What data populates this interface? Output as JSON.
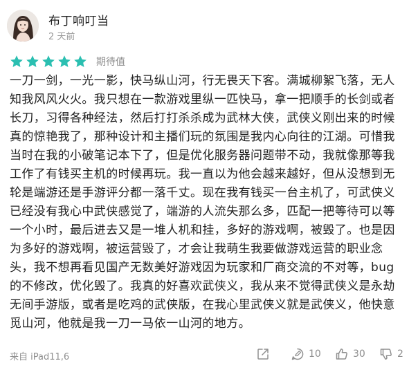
{
  "review": {
    "user": {
      "name": "布丁响叮当",
      "time": "2 天前",
      "avatar_icon": "user-avatar"
    },
    "rating": {
      "stars": 5,
      "max": 5,
      "label": "期待值",
      "star_color": "#2bbfb1"
    },
    "content": "一刀一剑，一光一影，快马纵山河，行无畏天下客。满城柳絮飞落，无人\n知我风风火火。我只想在一款游戏里纵一匹快马，拿一把顺手的长剑或者\n长刀，习得各种经法，然后打打杀杀成为武林大侠，武侠义刚出来的时候\n真的惊艳我了，那种设计和主播们玩的氛围是我内心向往的江湖。可惜我\n当时在我的小破笔记本下了，但是优化服务器问题带不动，我就像那等我\n工作了有钱买主机的时候再玩。我一直以为他会越来越好，但从没想到无\n轮是端游还是手游评分都一落千丈。现在我有钱买一台主机了，可武侠义\n已经没有我心中武侠感觉了，端游的人流失那么多，匹配一把等待可以等\n一个小时，最后进去又是一堆人机和挂，多好的游戏啊，被毁了。也是因\n为多好的游戏啊，被运营毁了，才会让我萌生我要做游戏运营的职业念\n头，我不想再看见国产无数美好游戏因为玩家和厂商交流的不对等，bug\n的不修改，优化毁了。我真的好喜欢武侠义，我从来不觉得武侠义是永劫\n无间手游版，或者是吃鸡的武侠版，在我心里武侠义就是武侠义，他快意\n觅山河，他就是我一刀一马依一山河的地方。",
    "footer": {
      "device": "来自 iPad11,6",
      "share_icon": "share-icon",
      "comment_icon": "comment-icon",
      "comments": "10",
      "like_icon": "thumbs-up-icon",
      "likes": "30",
      "dislike_icon": "thumbs-down-icon",
      "dislikes": "2"
    }
  }
}
